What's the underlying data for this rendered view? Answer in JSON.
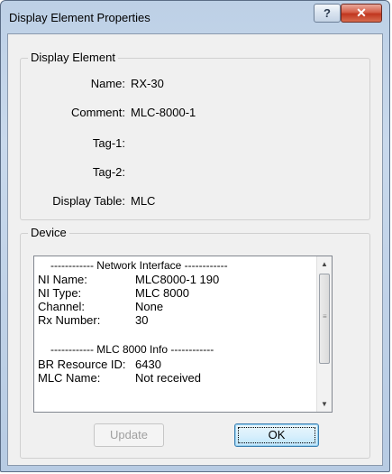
{
  "window": {
    "title": "Display Element Properties",
    "help_glyph": "?",
    "close_glyph": "✕"
  },
  "display_element": {
    "group_label": "Display Element",
    "fields": [
      {
        "label": "Name:",
        "value": "RX-30"
      },
      {
        "label": "Comment:",
        "value": "MLC-8000-1"
      },
      {
        "label": "Tag-1:",
        "value": ""
      },
      {
        "label": "Tag-2:",
        "value": ""
      },
      {
        "label": "Display Table:",
        "value": "MLC"
      }
    ]
  },
  "device": {
    "group_label": "Device",
    "list": {
      "network_header": "------------ Network Interface ------------",
      "network_rows": [
        {
          "key": "NI Name:",
          "value": "MLC8000-1 190"
        },
        {
          "key": "NI Type:",
          "value": "MLC 8000"
        },
        {
          "key": "Channel:",
          "value": "None"
        },
        {
          "key": "Rx Number:",
          "value": "30"
        }
      ],
      "mlc_header": "------------ MLC 8000 Info ------------",
      "mlc_rows": [
        {
          "key": "BR Resource ID:",
          "value": "6430"
        },
        {
          "key": "MLC Name:",
          "value": "Not received"
        }
      ],
      "scroll_up_glyph": "▲",
      "scroll_down_glyph": "▼",
      "grip_glyph": "≡"
    }
  },
  "buttons": {
    "update_label": "Update",
    "ok_label": "OK"
  }
}
